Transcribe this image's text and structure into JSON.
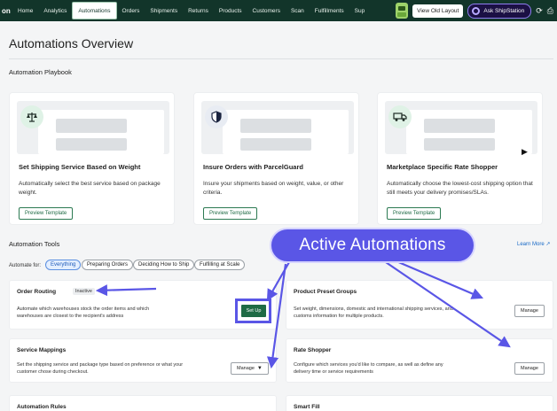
{
  "nav": {
    "brand": "on",
    "items": [
      {
        "label": "Home",
        "active": false
      },
      {
        "label": "Analytics",
        "active": false
      },
      {
        "label": "Automations",
        "active": true
      },
      {
        "label": "Orders",
        "active": false
      },
      {
        "label": "Shipments",
        "active": false
      },
      {
        "label": "Returns",
        "active": false
      },
      {
        "label": "Products",
        "active": false
      },
      {
        "label": "Customers",
        "active": false
      },
      {
        "label": "Scan",
        "active": false
      },
      {
        "label": "Fulfillments",
        "active": false
      },
      {
        "label": "Sup",
        "active": false
      }
    ],
    "view_old_layout": "View Old Layout",
    "ask_label": "Ask ShipStation"
  },
  "page": {
    "title": "Automations Overview"
  },
  "playbook": {
    "title": "Automation Playbook",
    "cards": [
      {
        "icon": "scale-icon",
        "title": "Set Shipping Service Based on Weight",
        "desc": "Automatically select the best service based on package weight.",
        "button": "Preview Template"
      },
      {
        "icon": "shield-icon",
        "title": "Insure Orders with ParcelGuard",
        "desc": "Insure your shipments based on weight, value, or other criteria.",
        "button": "Preview Template"
      },
      {
        "icon": "truck-icon",
        "title": "Marketplace Specific Rate Shopper",
        "desc": "Automatically choose the lowest-cost shipping option that still meets your delivery promises/SLAs.",
        "button": "Preview Template"
      }
    ]
  },
  "tools": {
    "title": "Automation Tools",
    "learn_more": "Learn More",
    "automate_for": "Automate for:",
    "filters": [
      "Everything",
      "Preparing Orders",
      "Deciding How to Ship",
      "Fulfilling at Scale"
    ],
    "cards": {
      "order_routing": {
        "title": "Order Routing",
        "badge": "Inactive",
        "desc": "Automate which warehouses stock the order items and which warehouses are closest to the recipient's address",
        "button": "Set Up"
      },
      "product_preset": {
        "title": "Product Preset Groups",
        "desc": "Set weight, dimensions, domestic and international shipping services, and customs information for multiple products.",
        "button": "Manage"
      },
      "service_mappings": {
        "title": "Service Mappings",
        "desc": "Set the shipping service and package type based on preference or what your customer chose during checkout.",
        "button": "Manage"
      },
      "rate_shopper": {
        "title": "Rate Shopper",
        "desc": "Configure which services you'd like to compare, as well as define any delivery time or service requirements",
        "button": "Manage"
      },
      "automation_rules": {
        "title": "Automation Rules"
      },
      "smart_fill": {
        "title": "Smart Fill"
      }
    }
  },
  "annotation": {
    "label": "Active Automations",
    "color": "#5a56e6"
  }
}
